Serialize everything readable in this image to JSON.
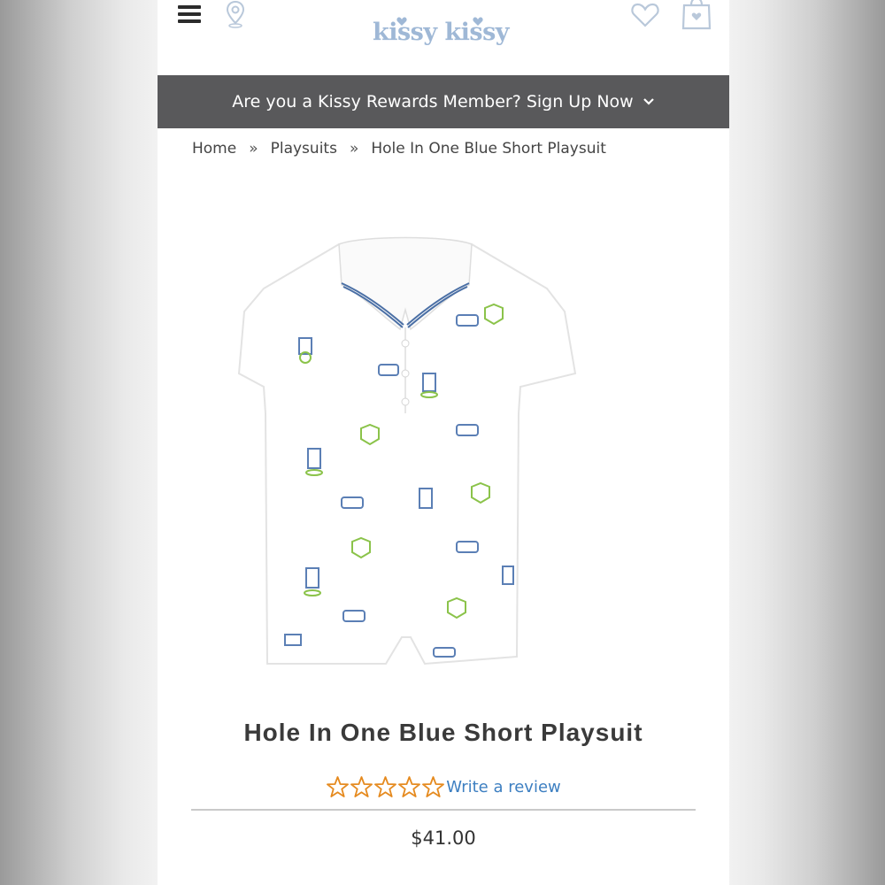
{
  "header": {
    "menu_icon": "hamburger-menu-icon",
    "location_icon": "map-pin-icon",
    "logo_text": "kissy kissy",
    "wishlist_icon": "heart-icon",
    "bag_icon": "shopping-bag-icon"
  },
  "rewards_banner": {
    "text": "Are you a Kissy Rewards Member? Sign Up Now",
    "icon": "chevron-down-icon"
  },
  "breadcrumb": {
    "items": [
      "Home",
      "Playsuits",
      "Hole In One Blue Short Playsuit"
    ],
    "separator": "»"
  },
  "product": {
    "title": "Hole In One Blue Short Playsuit",
    "rating": 0,
    "rating_max": 5,
    "review_link": "Write a review",
    "price": "$41.00"
  },
  "colors": {
    "banner_bg": "#59595b",
    "star_outline": "#e58a1f",
    "link": "#3d7fc1",
    "logo": "#9fb8d6"
  }
}
